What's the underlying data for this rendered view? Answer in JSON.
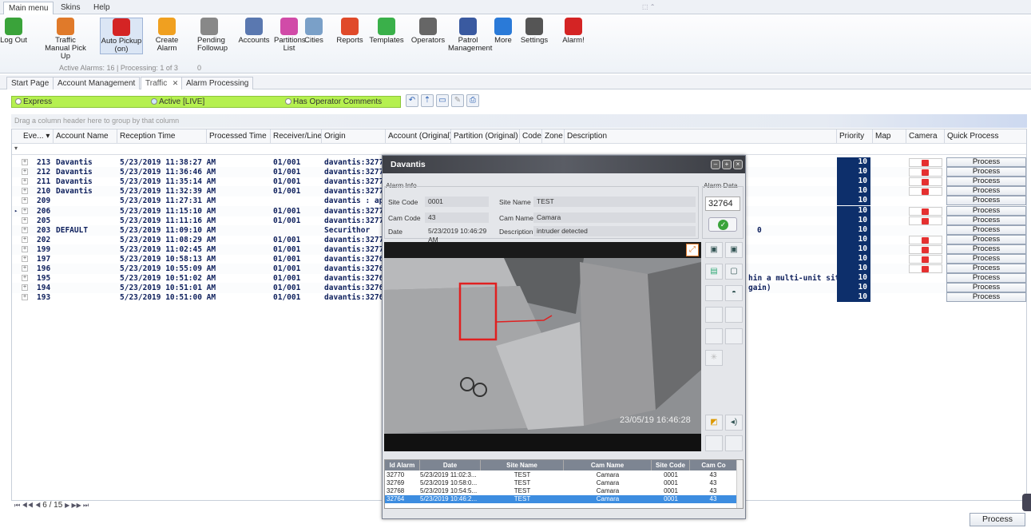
{
  "menu_tabs": [
    "Main menu",
    "Skins",
    "Help"
  ],
  "ribbon": {
    "buttons": [
      {
        "label": "Log Out",
        "icon": "logout-icon",
        "color": "#3aa33a"
      },
      {
        "label": "Traffic\nManual Pick Up",
        "icon": "traffic-icon",
        "color": "#e07a2a"
      },
      {
        "label": "Auto Pickup\n(on)",
        "icon": "siren-icon",
        "color": "#d42424"
      },
      {
        "label": "Create Alarm",
        "icon": "create-alarm-icon",
        "color": "#f0a020"
      },
      {
        "label": "Pending\nFollowup",
        "icon": "stopwatch-icon",
        "color": "#888888"
      },
      {
        "label": "Accounts",
        "icon": "accounts-icon",
        "color": "#5a78b0"
      },
      {
        "label": "Partitions\nList",
        "icon": "partitions-icon",
        "color": "#d14ba8"
      },
      {
        "label": "Cities",
        "icon": "cities-icon",
        "color": "#7aa0c8"
      },
      {
        "label": "Reports",
        "icon": "reports-icon",
        "color": "#e04a2a"
      },
      {
        "label": "Templates",
        "icon": "templates-icon",
        "color": "#3ab04a"
      },
      {
        "label": "Operators",
        "icon": "operators-icon",
        "color": "#666666"
      },
      {
        "label": "Patrol\nManagement",
        "icon": "patrol-icon",
        "color": "#3a5aa0"
      },
      {
        "label": "More",
        "icon": "plus-icon",
        "color": "#2a7ad8"
      },
      {
        "label": "Settings",
        "icon": "settings-icon",
        "color": "#555555"
      },
      {
        "label": "Alarm!",
        "icon": "alarm-icon",
        "color": "#d42424"
      }
    ],
    "status": "Active Alarms: 16 | Processing: 1 of 3",
    "pending_count": "0"
  },
  "page_tabs": [
    "Start Page",
    "Account Management",
    "Traffic",
    "Alarm Processing"
  ],
  "filters": {
    "express": "Express",
    "active": "Active [LIVE]",
    "operator_comments": "Has Operator Comments"
  },
  "grid": {
    "group_hint": "Drag a column header here to group by that column",
    "columns": [
      "Eve...",
      "Account Name",
      "Reception Time",
      "Processed Time",
      "Receiver/Line",
      "Origin",
      "Account (Original)",
      "Partition (Original)",
      "Code",
      "Zone",
      "Description",
      "Priority",
      "Map",
      "Camera",
      "Quick Process"
    ],
    "rows": [
      {
        "id": "213",
        "account": "Davantis",
        "reception": "5/23/2019 11:38:27 AM",
        "receiver": "01/001",
        "origin": "davantis:32777",
        "desc": "",
        "priority": "10",
        "camera": true,
        "process": "Process"
      },
      {
        "id": "212",
        "account": "Davantis",
        "reception": "5/23/2019 11:36:46 AM",
        "receiver": "01/001",
        "origin": "davantis:32776",
        "desc": "",
        "priority": "10",
        "camera": true,
        "process": "Process"
      },
      {
        "id": "211",
        "account": "Davantis",
        "reception": "5/23/2019 11:35:14 AM",
        "receiver": "01/001",
        "origin": "davantis:32775",
        "desc": "",
        "priority": "10",
        "camera": true,
        "process": "Process"
      },
      {
        "id": "210",
        "account": "Davantis",
        "reception": "5/23/2019 11:32:39 AM",
        "receiver": "01/001",
        "origin": "davantis:32774",
        "desc": "",
        "priority": "10",
        "camera": true,
        "process": "Process"
      },
      {
        "id": "209",
        "account": "",
        "reception": "5/23/2019 11:27:31 AM",
        "receiver": "",
        "origin": "davantis : ap",
        "desc": "",
        "priority": "10",
        "camera": false,
        "process": "Process"
      },
      {
        "id": "206",
        "account": "",
        "reception": "5/23/2019 11:15:10 AM",
        "receiver": "01/001",
        "origin": "davantis:32773",
        "desc": "",
        "priority": "10",
        "camera": true,
        "process": "Process"
      },
      {
        "id": "205",
        "account": "",
        "reception": "5/23/2019 11:11:16 AM",
        "receiver": "01/001",
        "origin": "davantis:32772",
        "desc": "",
        "priority": "10",
        "camera": true,
        "process": "Process"
      },
      {
        "id": "203",
        "account": "DEFAULT",
        "reception": "5/23/2019 11:09:10 AM",
        "receiver": "",
        "origin": "Securithor",
        "desc": "0",
        "priority": "10",
        "camera": false,
        "process": "Process"
      },
      {
        "id": "202",
        "account": "",
        "reception": "5/23/2019 11:08:29 AM",
        "receiver": "01/001",
        "origin": "davantis:32771",
        "desc": "",
        "priority": "10",
        "camera": true,
        "process": "Process"
      },
      {
        "id": "199",
        "account": "",
        "reception": "5/23/2019 11:02:45 AM",
        "receiver": "01/001",
        "origin": "davantis:32770",
        "desc": "",
        "priority": "10",
        "camera": true,
        "process": "Process"
      },
      {
        "id": "197",
        "account": "",
        "reception": "5/23/2019 10:58:13 AM",
        "receiver": "01/001",
        "origin": "davantis:32769",
        "desc": "",
        "priority": "10",
        "camera": true,
        "process": "Process"
      },
      {
        "id": "196",
        "account": "",
        "reception": "5/23/2019 10:55:09 AM",
        "receiver": "01/001",
        "origin": "davantis:32768",
        "desc": "",
        "priority": "10",
        "camera": true,
        "process": "Process"
      },
      {
        "id": "195",
        "account": "",
        "reception": "5/23/2019 10:51:02 AM",
        "receiver": "01/001",
        "origin": "davantis:32767",
        "desc": "hin a multi-unit site",
        "priority": "10",
        "camera": false,
        "process": "Process"
      },
      {
        "id": "194",
        "account": "",
        "reception": "5/23/2019 10:51:01 AM",
        "receiver": "01/001",
        "origin": "davantis:32766",
        "desc": "gain)",
        "priority": "10",
        "camera": false,
        "process": "Process"
      },
      {
        "id": "193",
        "account": "",
        "reception": "5/23/2019 10:51:00 AM",
        "receiver": "01/001",
        "origin": "davantis:32765",
        "desc": "",
        "priority": "10",
        "camera": false,
        "process": "Process"
      }
    ]
  },
  "pager": "6 / 15",
  "bottom_process": "Process",
  "modal": {
    "title": "Davantis",
    "alarm_info_label": "Alarm Info",
    "site_code_label": "Site Code",
    "site_code": "0001",
    "site_name_label": "Site Name",
    "site_name": "TEST",
    "cam_code_label": "Cam Code",
    "cam_code": "43",
    "cam_name_label": "Cam Name",
    "cam_name": "Camara",
    "date_label": "Date",
    "date": "5/23/2019 10:46:29 AM",
    "description_label": "Description",
    "description": "intruder detected",
    "alarm_data_label": "Alarm Data",
    "alarm_data_value": "32764",
    "video_timestamp": "23/05/19 16:46:28",
    "table": {
      "headers": [
        "Id Alarm",
        "Date",
        "Site Name",
        "Cam Name",
        "Site Code",
        "Cam Co"
      ],
      "rows": [
        [
          "32770",
          "5/23/2019 11:02:3...",
          "TEST",
          "Camara",
          "0001",
          "43"
        ],
        [
          "32769",
          "5/23/2019 10:58:0...",
          "TEST",
          "Camara",
          "0001",
          "43"
        ],
        [
          "32768",
          "5/23/2019 10:54:5...",
          "TEST",
          "Camara",
          "0001",
          "43"
        ],
        [
          "32764",
          "5/23/2019 10:46:2...",
          "TEST",
          "Camara",
          "0001",
          "43"
        ]
      ],
      "selected_index": 3
    }
  }
}
